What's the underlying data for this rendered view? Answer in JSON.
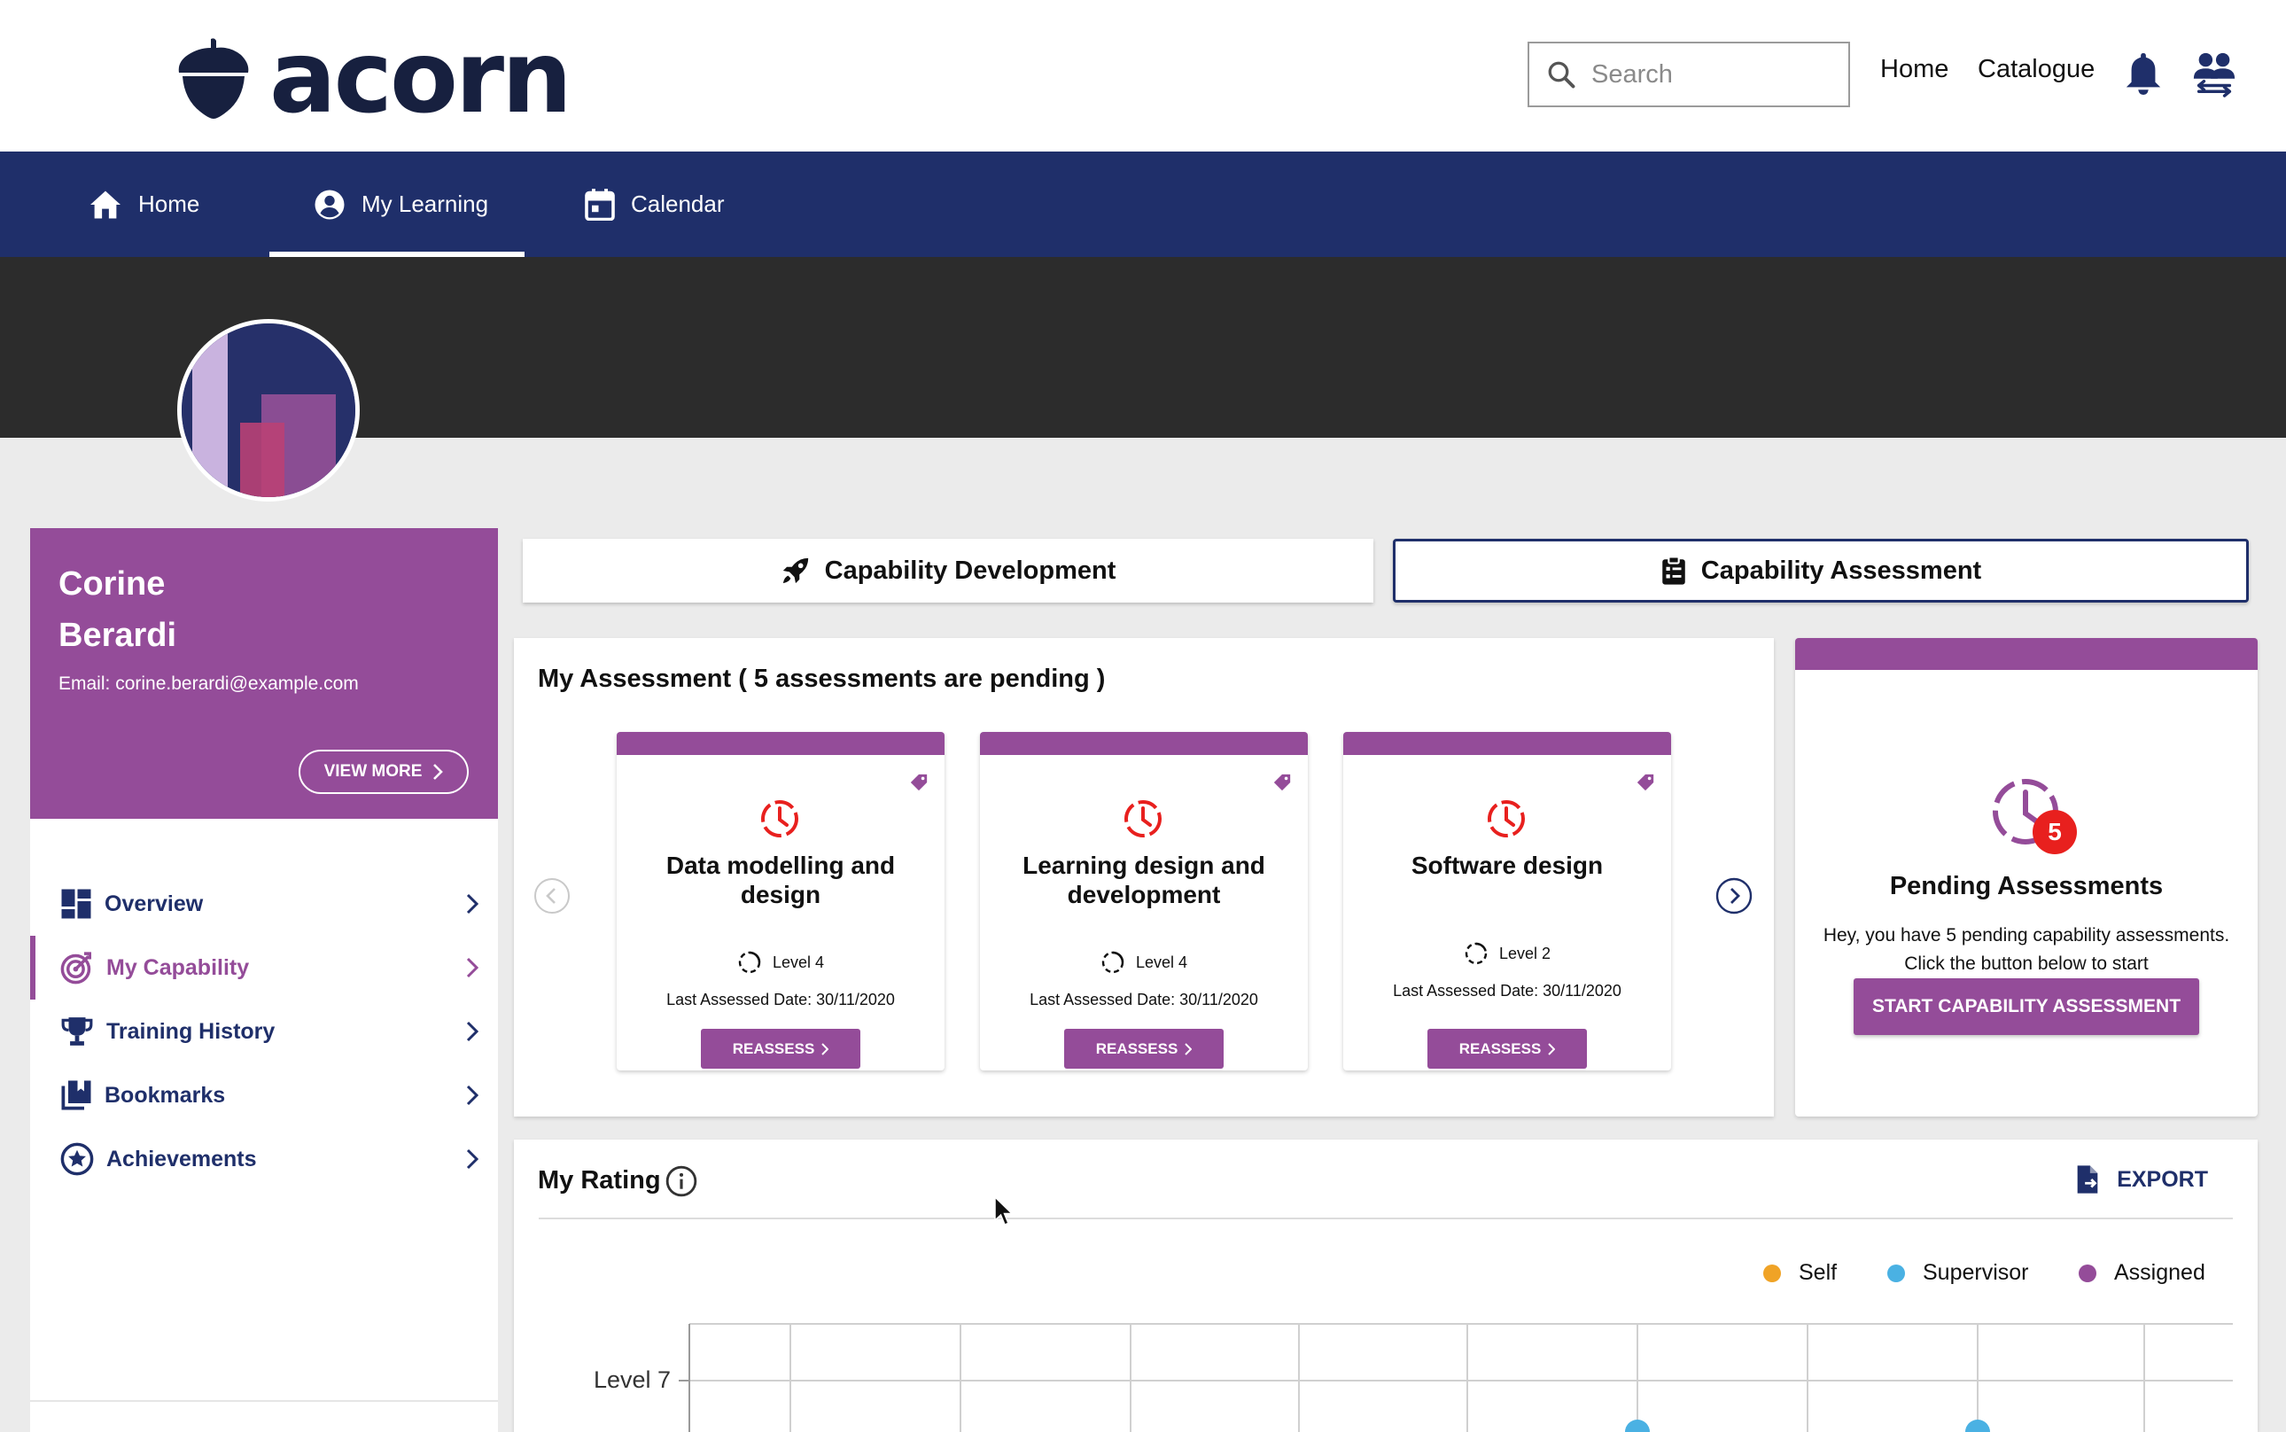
{
  "header": {
    "logo_text": "acorn",
    "search_placeholder": "Search",
    "links": {
      "home": "Home",
      "catalogue": "Catalogue"
    }
  },
  "nav": {
    "items": [
      {
        "label": "Home",
        "icon": "home-icon"
      },
      {
        "label": "My Learning",
        "icon": "account-circle-icon",
        "active": true
      },
      {
        "label": "Calendar",
        "icon": "calendar-icon"
      }
    ]
  },
  "profile": {
    "first_name": "Corine",
    "last_name": "Berardi",
    "email_label": "Email:",
    "email": "corine.berardi@example.com",
    "view_more": "VIEW MORE"
  },
  "sidebar": {
    "items": [
      {
        "label": "Overview",
        "icon": "dashboard-icon"
      },
      {
        "label": "My Capability",
        "icon": "target-icon",
        "active": true
      },
      {
        "label": "Training History",
        "icon": "trophy-icon"
      },
      {
        "label": "Bookmarks",
        "icon": "bookmarks-icon"
      },
      {
        "label": "Achievements",
        "icon": "star-badge-icon"
      }
    ]
  },
  "tabs": {
    "development": "Capability Development",
    "assessment": "Capability Assessment"
  },
  "assessment": {
    "title": "My Assessment ( 5 assessments are pending )",
    "cards": [
      {
        "title": "Data modelling and design",
        "level": "Level 4",
        "date": "Last Assessed Date: 30/11/2020",
        "button": "REASSESS"
      },
      {
        "title": "Learning design and development",
        "level": "Level 4",
        "date": "Last Assessed Date: 30/11/2020",
        "button": "REASSESS"
      },
      {
        "title": "Software design",
        "level": "Level 2",
        "date": "Last Assessed Date: 30/11/2020",
        "button": "REASSESS"
      }
    ]
  },
  "pending": {
    "count": "5",
    "title": "Pending Assessments",
    "line1": "Hey, you have 5 pending capability assessments.",
    "line2": "Click the button below to start",
    "button": "START CAPABILITY ASSESSMENT"
  },
  "rating": {
    "title": "My Rating",
    "export": "EXPORT",
    "legend": [
      {
        "label": "Self",
        "color": "#f0a326"
      },
      {
        "label": "Supervisor",
        "color": "#4ab1e3"
      },
      {
        "label": "Assigned",
        "color": "#944c99"
      }
    ],
    "y_tick_top": "Level 7"
  },
  "colors": {
    "brand_navy": "#1f2f6a",
    "brand_purple": "#944c99",
    "alert_red": "#e8201e"
  }
}
